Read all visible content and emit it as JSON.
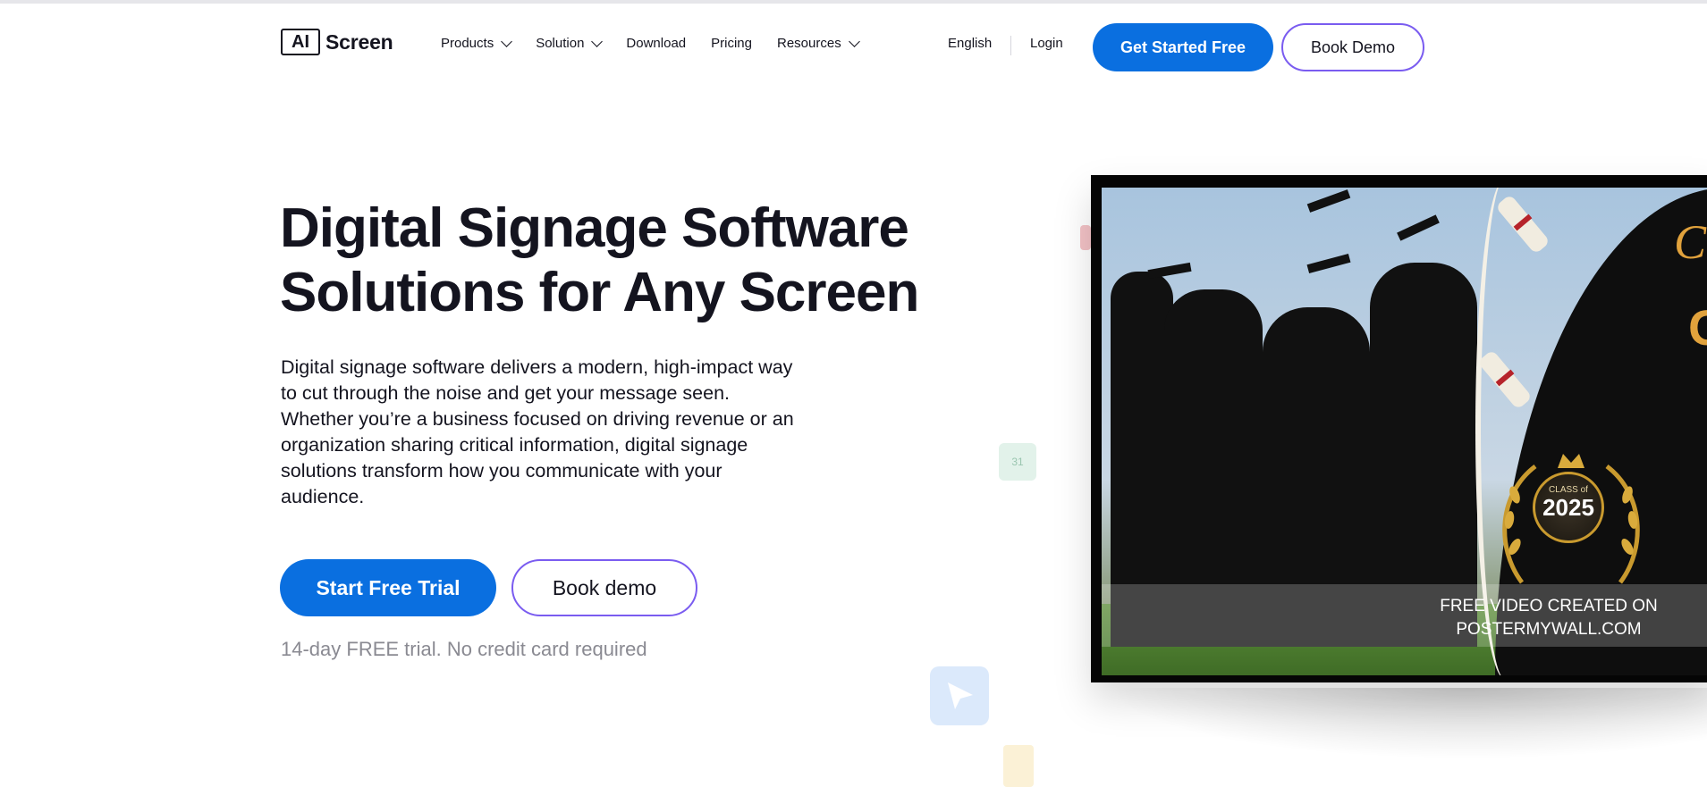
{
  "nav": {
    "logo_mark": "AI",
    "logo_text": "Screen",
    "menu": [
      {
        "label": "Products",
        "has_dropdown": true
      },
      {
        "label": "Solution",
        "has_dropdown": true
      },
      {
        "label": "Download",
        "has_dropdown": false
      },
      {
        "label": "Pricing",
        "has_dropdown": false
      },
      {
        "label": "Resources",
        "has_dropdown": true
      }
    ],
    "language": "English",
    "login": "Login",
    "cta_primary": "Get Started Free",
    "cta_secondary": "Book Demo"
  },
  "hero": {
    "title_line1": "Digital Signage Software",
    "title_line2": "Solutions for Any Screen",
    "description": "Digital signage software delivers a modern, high-impact way to cut through the noise and get your message seen. Whether you’re a business focused on driving revenue or an organization sharing critical information, digital signage solutions transform how you communicate with your audience.",
    "start_trial": "Start Free Trial",
    "book_demo": "Book demo",
    "trial_note": "14-day FREE trial. No credit card required"
  },
  "screen_preview": {
    "class_label": "CLASS of",
    "class_year": "2025",
    "watermark_line1": "FREE VIDEO CREATED ON",
    "watermark_line2": "POSTERMYWALL.COM"
  },
  "colors": {
    "primary": "#0a6fe0",
    "outline_accent": "#7a5cf0",
    "text": "#14141f",
    "muted": "#8a8a92",
    "gold": "#e1a23c"
  },
  "icons": [
    "chevron-down-icon",
    "calendar-icon",
    "arrow-pointer-icon"
  ]
}
